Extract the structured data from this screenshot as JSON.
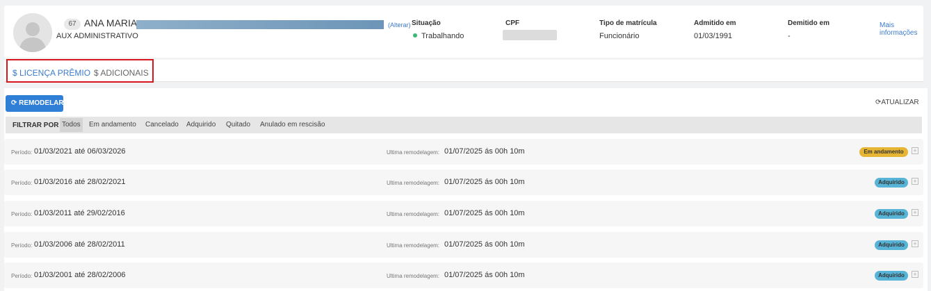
{
  "employee": {
    "badge": "67",
    "name": "ANA MARIA",
    "alterar": "(Alterar)",
    "role": "AUX ADMINISTRATIVO"
  },
  "info": {
    "situacao_label": "Situação",
    "situacao_value": "Trabalhando",
    "cpf_label": "CPF",
    "matricula_label": "Tipo de matrícula",
    "matricula_value": "Funcionário",
    "admitido_label": "Admitido em",
    "admitido_value": "01/03/1991",
    "demitido_label": "Demitido em",
    "demitido_value": "-",
    "mais_info_1": "Mais",
    "mais_info_2": "informações"
  },
  "tabs": [
    {
      "label": "$ LICENÇA PRÊMIO",
      "active": true
    },
    {
      "label": "$ ADICIONAIS",
      "active": false
    }
  ],
  "toolbar": {
    "remodelar": "REMODELAR",
    "atualizar": "ATUALIZAR"
  },
  "filter": {
    "label": "FILTRAR POR",
    "options": [
      "Todos",
      "Em andamento",
      "Cancelado",
      "Adquirido",
      "Quitado",
      "Anulado em rescisão"
    ],
    "selected": "Todos"
  },
  "rows_labels": {
    "periodo": "Período:",
    "remodelagem": "Ultima remodelagem:"
  },
  "rows": [
    {
      "periodo": "01/03/2021 até 06/03/2026",
      "remodelagem": "01/07/2025 ás 00h 10m",
      "status": "Em andamento"
    },
    {
      "periodo": "01/03/2016 até 28/02/2021",
      "remodelagem": "01/07/2025 ás 00h 10m",
      "status": "Adquirido"
    },
    {
      "periodo": "01/03/2011 até 29/02/2016",
      "remodelagem": "01/07/2025 ás 00h 10m",
      "status": "Adquirido"
    },
    {
      "periodo": "01/03/2006 até 28/02/2011",
      "remodelagem": "01/07/2025 ás 00h 10m",
      "status": "Adquirido"
    },
    {
      "periodo": "01/03/2001 até 28/02/2006",
      "remodelagem": "01/07/2025 ás 00h 10m",
      "status": "Adquirido"
    }
  ],
  "colors": {
    "accent": "#2f7fd6",
    "em_andamento": "#e6b533",
    "adquirido": "#58b4d6",
    "highlight": "#d9161c"
  }
}
